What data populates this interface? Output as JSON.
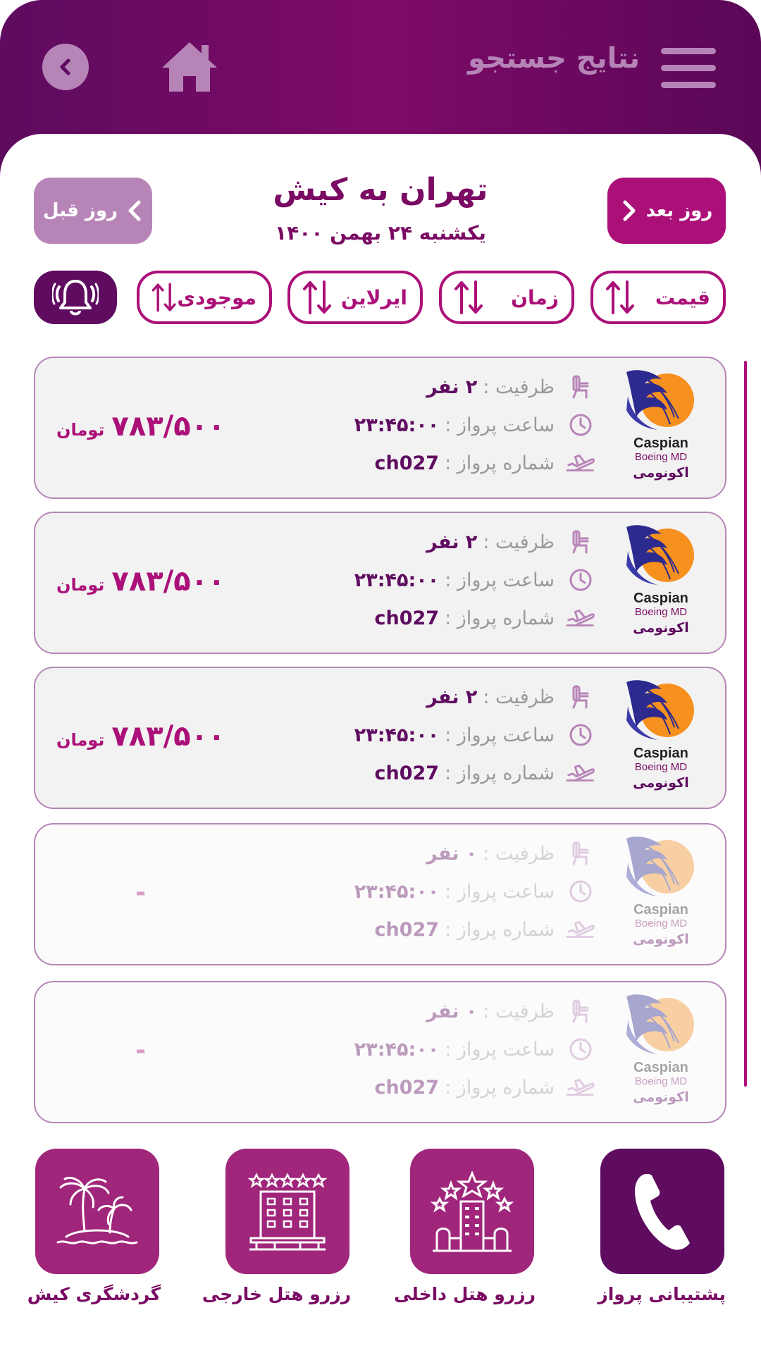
{
  "header": {
    "title": "نتایج جستجو",
    "back_icon": "chevron-left-icon",
    "home_icon": "home-icon",
    "menu_icon": "hamburger-menu-icon"
  },
  "route": {
    "title": "تهران به کیش",
    "date": "یکشنبه ۲۴ بهمن ۱۴۰۰",
    "prev_day": "روز قبل",
    "next_day": "روز بعد"
  },
  "sort": {
    "price": "قیمت",
    "time": "زمان",
    "airline": "ایرلاین",
    "availability": "موجودی"
  },
  "labels": {
    "capacity": "ظرفیت :",
    "departure": "ساعت پرواز :",
    "flight_number": "شماره پرواز :",
    "currency": "تومان"
  },
  "flights": [
    {
      "airline": "Caspian",
      "aircraft": "Boeing MD",
      "cabin": "اکونومی",
      "capacity": "۲ نفر",
      "time": "۲۳:۴۵:۰۰",
      "number": "ch027",
      "price": "۷۸۳/۵۰۰",
      "available": true
    },
    {
      "airline": "Caspian",
      "aircraft": "Boeing MD",
      "cabin": "اکونومی",
      "capacity": "۲ نفر",
      "time": "۲۳:۴۵:۰۰",
      "number": "ch027",
      "price": "۷۸۳/۵۰۰",
      "available": true
    },
    {
      "airline": "Caspian",
      "aircraft": "Boeing MD",
      "cabin": "اکونومی",
      "capacity": "۲ نفر",
      "time": "۲۳:۴۵:۰۰",
      "number": "ch027",
      "price": "۷۸۳/۵۰۰",
      "available": true
    },
    {
      "airline": "Caspian",
      "aircraft": "Boeing MD",
      "cabin": "اکونومی",
      "capacity": "۰ نفر",
      "time": "۲۳:۴۵:۰۰",
      "number": "ch027",
      "price": "-",
      "available": false
    },
    {
      "airline": "Caspian",
      "aircraft": "Boeing MD",
      "cabin": "اکونومی",
      "capacity": "۰ نفر",
      "time": "۲۳:۴۵:۰۰",
      "number": "ch027",
      "price": "-",
      "available": false
    }
  ],
  "services": {
    "support": "پشتیبانی پرواز",
    "domestic_hotel": "رزرو هتل داخلی",
    "foreign_hotel": "رزرو هتل خارجی",
    "kish_tour": "گردشگری کیش"
  },
  "colors": {
    "primary": "#ab1078",
    "dark": "#5e0b60",
    "muted": "#b784b8"
  }
}
